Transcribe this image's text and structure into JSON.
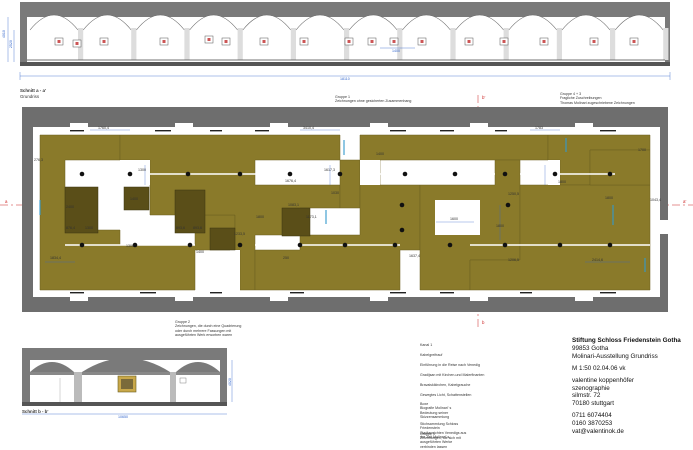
{
  "section_aa": {
    "label": "Schnitt a - a'",
    "sub": "Grundriss"
  },
  "section_bb": {
    "label": "Schnitt b - b'"
  },
  "groups": {
    "g1": [
      "Gruppe 1",
      "Zeichnungen ohne gesicherten Zusammenhang"
    ],
    "g2": [
      "Gruppe 2",
      "Zeichnungen, die durch eine Quadrierung",
      "oder durch mehrere Fassungen mit",
      "ausgeführten Werk erworben waren"
    ],
    "g3": [
      "Gruppe 4 + 3",
      "Fragliche Zuschreibungen",
      "Thomas Molinari zugeschriebene Zeichnungen"
    ]
  },
  "axis_marks": {
    "a_left": "a",
    "a_right": "a'",
    "b_top": "b'",
    "b_bottom": "b"
  },
  "dims": {
    "elev_h1": "4010",
    "elev_h2": "2520",
    "elev_w": "18110",
    "elev_inner": "1400",
    "d1": "1760,4",
    "d2": "3410,4",
    "d3": "1783",
    "d4": "1700",
    "d5": "1300",
    "d6": "1400",
    "d7": "1676,4",
    "d8": "1617,3",
    "d9": "1030",
    "d10": "1250,5",
    "d11": "1800",
    "d12": "1043,4",
    "d13": "2400",
    "d14": "876,4",
    "d15": "1300",
    "d16": "893,6",
    "d17": "893,6",
    "d18": "1233,5",
    "d19": "1083,1",
    "d20": "1173,1",
    "d21": "1800",
    "d22": "1400",
    "d23": "1637,4",
    "d24": "1206,5",
    "d25": "2414,6",
    "d26": "1834,4",
    "d27": "1600",
    "d28": "1800",
    "d29": "250",
    "d30": "1400",
    "d31": "1300",
    "d32": "276,3",
    "d33": "1800",
    "bb_w": "10650",
    "bb_h": "4020"
  },
  "legend": [
    "Kanal 1",
    "Kabelgreifrauf",
    "Einführung in die Reise nach Venedig",
    "Gradijsan mit Kirchen-und Malerfinanten",
    "Bravaiskikirchen, Kabelgrauche",
    "Gewegtes Licht, Schattenstellen"
  ],
  "legend2": [
    "Boxe",
    "Biografie Molinari' s",
    "Bedeutung seiner",
    "Skizzensammlung"
  ],
  "legend3": [
    "Stichsammlung Schloss",
    "Friedenstein",
    "Stadtansichten Venedigs aus",
    "der Zeit Molinari' s"
  ],
  "legend4": [
    "Gruppe 1",
    "Zeichnungen, die sich mit",
    "ausgeführten Werke",
    "verbinden lassen"
  ],
  "title_block": {
    "org": "Stiftung Schloss Friedenstein Gotha",
    "city": "99853 Gotha",
    "project": "Molinari-Ausstellung Grundriss",
    "scale": "M 1:50  02.04.06 vk",
    "designer": "valentine koppenhöfer",
    "role": "szenographie",
    "street": "silmstr. 72",
    "zip": "70180 stuttgart",
    "phone": "0711 6074404",
    "mobile": "0160 3870253",
    "email": "vat@valentinok.de"
  }
}
